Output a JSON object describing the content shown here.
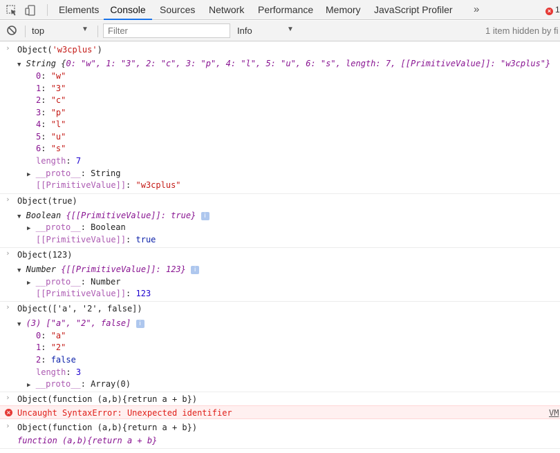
{
  "tabs": [
    "Elements",
    "Console",
    "Sources",
    "Network",
    "Performance",
    "Memory",
    "JavaScript Profiler"
  ],
  "more_tabs": "»",
  "error_count": "1",
  "toolbar": {
    "context": "top",
    "filter_placeholder": "Filter",
    "level": "Info",
    "hidden_text": "1 item hidden by fi"
  },
  "console": {
    "l1_in": "Object(",
    "l1_arg": "'w3cplus'",
    "l1_close": ")",
    "l2_type": "String",
    "l2_open": " {",
    "l2_rest": "0: \"w\", 1: \"3\", 2: \"c\", 3: \"p\", 4: \"l\", 5: \"u\", 6: \"s\", length: 7, [[PrimitiveValue]]: \"w3cplus\"}",
    "s_keys": [
      "0",
      "1",
      "2",
      "3",
      "4",
      "5",
      "6"
    ],
    "s_vals": [
      "\"w\"",
      "\"3\"",
      "\"c\"",
      "\"p\"",
      "\"l\"",
      "\"u\"",
      "\"s\""
    ],
    "length_key": "length",
    "s_length_val": "7",
    "proto_key": "__proto__",
    "s_proto_val": "String",
    "pv_key": "[[PrimitiveValue]]",
    "s_pv_val": "\"w3cplus\"",
    "b_in": "Object(true)",
    "b_type": "Boolean",
    "b_sum": "{[[PrimitiveValue]]: true}",
    "b_proto_val": "Boolean",
    "b_pv_val": "true",
    "n_in": "Object(123)",
    "n_type": "Number",
    "n_sum": "{[[PrimitiveValue]]: 123}",
    "n_proto_val": "Number",
    "n_pv_val": "123",
    "a_in": "Object(['a', '2', false])",
    "a_sum": "(3) [\"a\", \"2\", false]",
    "a_keys": [
      "0",
      "1",
      "2"
    ],
    "a_vals": [
      "\"a\"",
      "\"2\"",
      "false"
    ],
    "a_length_val": "3",
    "a_proto_val": "Array(0)",
    "f1_in": "Object(function (a,b){retrun a + b})",
    "err": "Uncaught SyntaxError: Unexpected identifier",
    "err_src": "VM",
    "f2_in": "Object(function (a,b){return a + b})",
    "f2_out": "function (a,b){return a + b}"
  }
}
